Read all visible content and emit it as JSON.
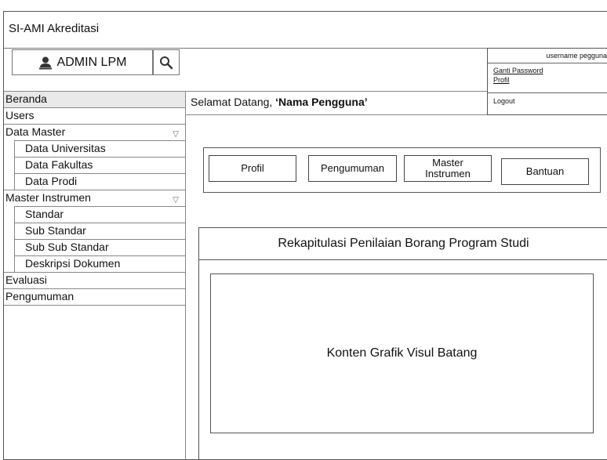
{
  "app": {
    "title": "SI-AMI Akreditasi"
  },
  "admin": {
    "label": "ADMIN LPM",
    "icon": "user-icon",
    "search_icon": "search-icon"
  },
  "sidebar": {
    "items": [
      {
        "label": "Beranda"
      },
      {
        "label": "Users"
      },
      {
        "label": "Data Master"
      },
      {
        "label": "Data Universitas"
      },
      {
        "label": "Data Fakultas"
      },
      {
        "label": "Data Prodi"
      },
      {
        "label": "Master Instrumen"
      },
      {
        "label": "Standar"
      },
      {
        "label": "Sub Standar"
      },
      {
        "label": "Sub Sub Standar"
      },
      {
        "label": "Deskripsi Dokumen"
      },
      {
        "label": "Evaluasi"
      },
      {
        "label": "Pengumuman"
      }
    ],
    "caret_icon": "triangle-down-icon"
  },
  "welcome": {
    "prefix": "Selamat Datang, ",
    "name": "‘Nama Pengguna’"
  },
  "user_menu": {
    "username": "username pegguna",
    "ganti_password": "Ganti Password",
    "profil": "Profil",
    "logout": "Logout"
  },
  "buttons": {
    "profil": "Profil",
    "pengumuman": "Pengumuman",
    "master_line1": "Master",
    "master_line2": "Instrumen",
    "bantuan": "Bantuan"
  },
  "recap": {
    "title": "Rekapitulasi  Penilaian Borang Program Studi",
    "chart_placeholder": "Konten Grafik Visul Batang"
  }
}
